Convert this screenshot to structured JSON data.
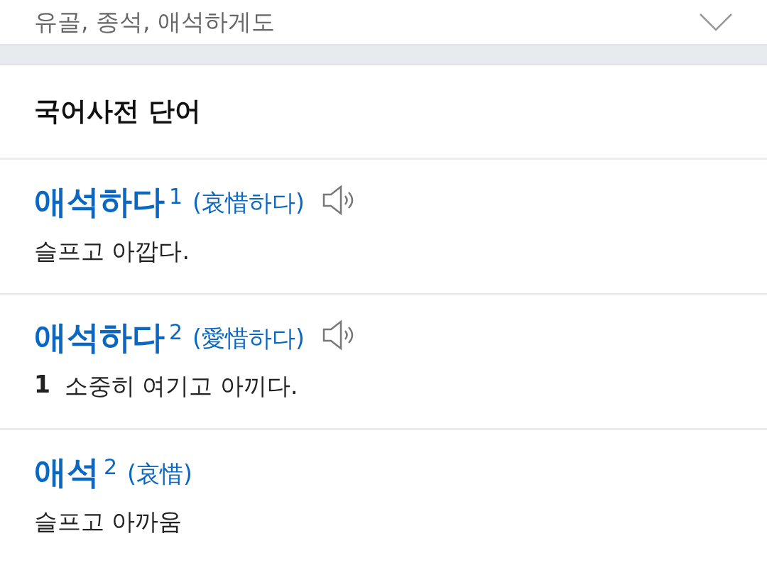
{
  "related": {
    "text": "유골, 종석, 애석하게도"
  },
  "section_title": "국어사전 단어",
  "entries": [
    {
      "word": "애석하다",
      "homograph": "1",
      "hanja": "(哀惜하다)",
      "has_audio": true,
      "definition": "슬프고 아깝다."
    },
    {
      "word": "애석하다",
      "homograph": "2",
      "hanja": "(愛惜하다)",
      "has_audio": true,
      "sense_number": "1",
      "definition": "소중히 여기고 아끼다."
    },
    {
      "word": "애석",
      "homograph": "2",
      "hanja": "(哀惜)",
      "has_audio": false,
      "definition": "슬프고 아까움"
    }
  ]
}
